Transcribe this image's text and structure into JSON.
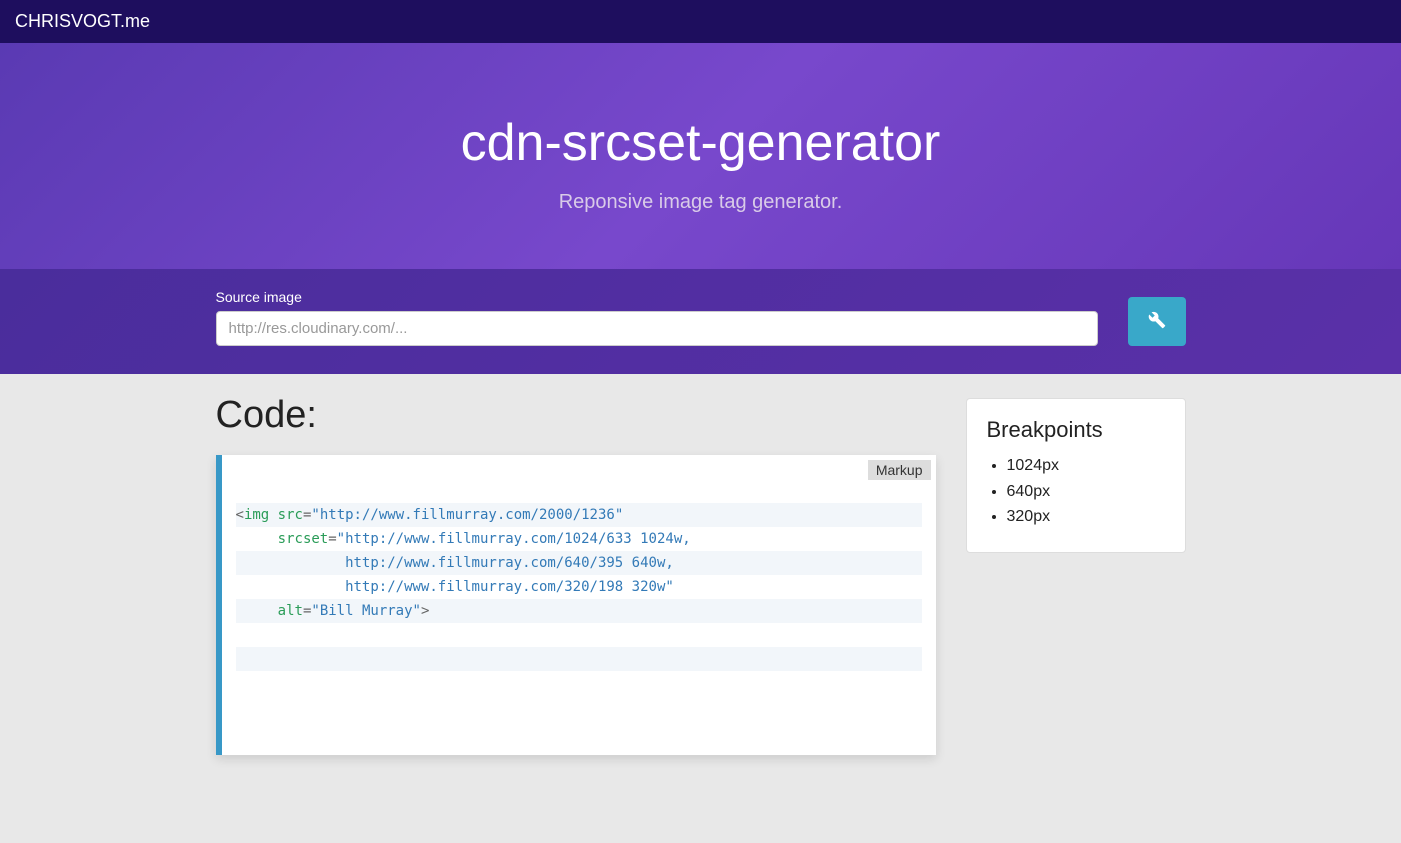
{
  "navbar": {
    "brand": "CHRISVOGT.me"
  },
  "hero": {
    "title": "cdn-srcset-generator",
    "subtitle": "Reponsive image tag generator."
  },
  "form": {
    "label": "Source image",
    "placeholder": "http://res.cloudinary.com/...",
    "value": ""
  },
  "code": {
    "heading": "Code:",
    "language": "Markup",
    "tag": "img",
    "attrs": {
      "src": "http://www.fillmurray.com/2000/1236",
      "srcset_lines": [
        "http://www.fillmurray.com/1024/633 1024w,",
        "http://www.fillmurray.com/640/395 640w,",
        "http://www.fillmurray.com/320/198 320w"
      ],
      "alt": "Bill Murray"
    }
  },
  "breakpoints": {
    "heading": "Breakpoints",
    "items": [
      "1024px",
      "640px",
      "320px"
    ]
  }
}
